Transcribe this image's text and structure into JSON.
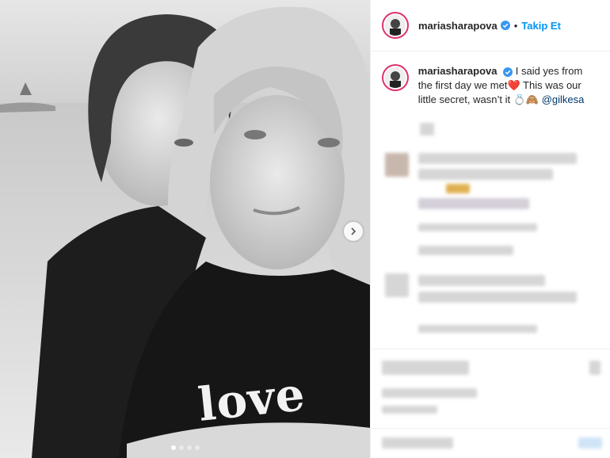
{
  "post": {
    "image_overlay_text": "love",
    "carousel": {
      "slide_count": 4,
      "active_index": 0
    }
  },
  "header": {
    "username": "mariasharapova",
    "separator": "•",
    "follow_label": "Takip Et"
  },
  "caption": {
    "username": "mariasharapova",
    "text": "I said yes from the first day we met❤️ This was our little secret, wasn’t it 💍🙈",
    "mention": "@gilkesa"
  },
  "colors": {
    "follow": "#0095f6",
    "story_ring": "#e0306b",
    "verified": "#3897f0"
  },
  "icons": {
    "verified": "verified-badge-icon",
    "next": "chevron-right-icon"
  }
}
